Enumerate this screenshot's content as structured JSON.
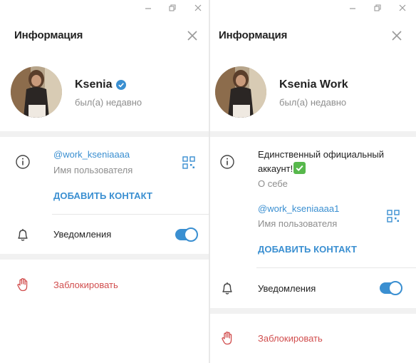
{
  "left_window": {
    "header": {
      "title": "Информация"
    },
    "profile": {
      "name": "Ksenia",
      "status": "был(а) недавно",
      "verified": true
    },
    "info": {
      "username": "@work_kseniaaaa",
      "username_caption": "Имя пользователя",
      "add_contact": "ДОБАВИТЬ КОНТАКТ"
    },
    "notifications": {
      "label": "Уведомления",
      "enabled": true
    },
    "block": {
      "label": "Заблокировать"
    }
  },
  "right_window": {
    "header": {
      "title": "Информация"
    },
    "profile": {
      "name": "Ksenia Work",
      "status": "был(а) недавно"
    },
    "info": {
      "bio_line1": "Единственный официальный",
      "bio_line2": "аккаунт!",
      "bio_caption": "О себе",
      "username": "@work_kseniaaaa1",
      "username_caption": "Имя пользователя",
      "add_contact": "ДОБАВИТЬ КОНТАКТ"
    },
    "notifications": {
      "label": "Уведомления",
      "enabled": true
    },
    "block": {
      "label": "Заблокировать"
    }
  },
  "icons": {
    "minimize": "minimize-icon",
    "maximize": "restore-icon",
    "close_window": "close-window-icon",
    "close_panel": "close-icon",
    "info": "info-icon",
    "qr": "qr-code-icon",
    "bell": "bell-icon",
    "block": "hand-stop-icon",
    "verified": "verified-badge-icon",
    "check_emoji": "check-mark-emoji"
  },
  "colors": {
    "accent": "#3a8fd1",
    "danger": "#d14e4e",
    "muted": "#8e8e8e",
    "check_emoji": "#57b84c"
  }
}
